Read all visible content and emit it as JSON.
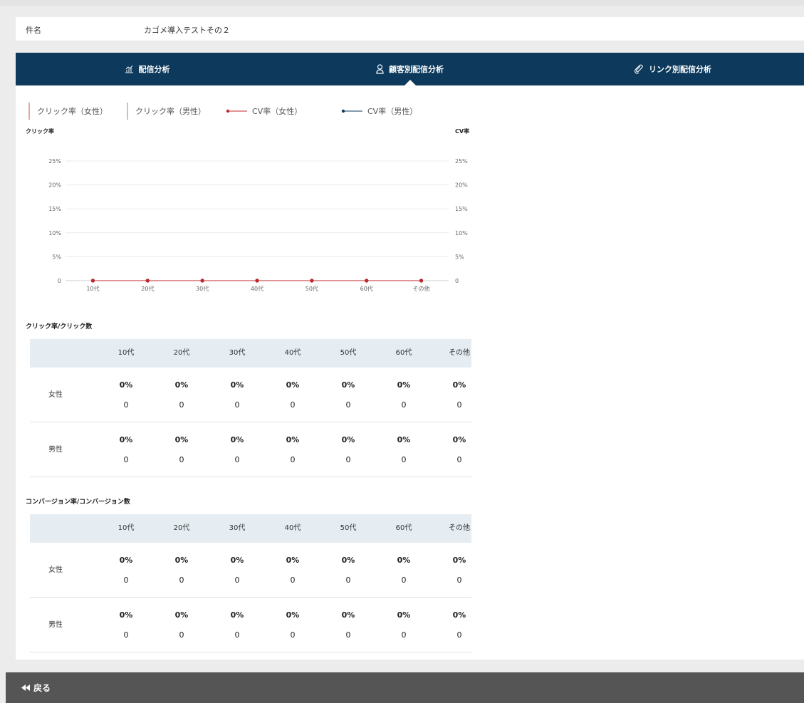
{
  "subject": {
    "label": "件名",
    "value": "カゴメ導入テストその２"
  },
  "tabs": [
    {
      "label": "配信分析",
      "icon": "bar-chart-icon"
    },
    {
      "label": "顧客別配信分析",
      "icon": "person-icon"
    },
    {
      "label": "リンク別配信分析",
      "icon": "paperclip-icon"
    }
  ],
  "legend": [
    {
      "label": "クリック率（女性）",
      "color": "#e8a3a3",
      "kind": "bar"
    },
    {
      "label": "クリック率（男性）",
      "color": "#a9cfcf",
      "kind": "bar"
    },
    {
      "label": "CV率（女性）",
      "color": "#c0282d",
      "kind": "line"
    },
    {
      "label": "CV率（男性）",
      "color": "#0d3a5c",
      "kind": "line"
    }
  ],
  "chart_data": {
    "type": "line",
    "categories": [
      "10代",
      "20代",
      "30代",
      "40代",
      "50代",
      "60代",
      "その他"
    ],
    "ylabel_left": "クリック率",
    "ylabel_right": "CV率",
    "yticks_left": [
      "0",
      "5%",
      "10%",
      "15%",
      "20%",
      "25%"
    ],
    "yticks_right": [
      "0",
      "5%",
      "10%",
      "15%",
      "20%",
      "25%"
    ],
    "ylim": [
      0,
      25
    ],
    "grid": true,
    "series": [
      {
        "name": "クリック率（女性）",
        "type": "bar",
        "values": [
          0,
          0,
          0,
          0,
          0,
          0,
          0
        ],
        "color": "#e8a3a3"
      },
      {
        "name": "クリック率（男性）",
        "type": "bar",
        "values": [
          0,
          0,
          0,
          0,
          0,
          0,
          0
        ],
        "color": "#a9cfcf"
      },
      {
        "name": "CV率（女性）",
        "type": "line",
        "values": [
          0,
          0,
          0,
          0,
          0,
          0,
          0
        ],
        "color": "#c0282d"
      },
      {
        "name": "CV率（男性）",
        "type": "line",
        "values": [
          0,
          0,
          0,
          0,
          0,
          0,
          0
        ],
        "color": "#0d3a5c"
      }
    ]
  },
  "click_table": {
    "title": "クリック率/クリック数",
    "columns": [
      "10代",
      "20代",
      "30代",
      "40代",
      "50代",
      "60代",
      "その他"
    ],
    "rows": [
      {
        "label": "女性",
        "pct": [
          "0%",
          "0%",
          "0%",
          "0%",
          "0%",
          "0%",
          "0%"
        ],
        "count": [
          "0",
          "0",
          "0",
          "0",
          "0",
          "0",
          "0"
        ]
      },
      {
        "label": "男性",
        "pct": [
          "0%",
          "0%",
          "0%",
          "0%",
          "0%",
          "0%",
          "0%"
        ],
        "count": [
          "0",
          "0",
          "0",
          "0",
          "0",
          "0",
          "0"
        ]
      }
    ]
  },
  "cv_table": {
    "title": "コンバージョン率/コンバージョン数",
    "columns": [
      "10代",
      "20代",
      "30代",
      "40代",
      "50代",
      "60代",
      "その他"
    ],
    "rows": [
      {
        "label": "女性",
        "pct": [
          "0%",
          "0%",
          "0%",
          "0%",
          "0%",
          "0%",
          "0%"
        ],
        "count": [
          "0",
          "0",
          "0",
          "0",
          "0",
          "0",
          "0"
        ]
      },
      {
        "label": "男性",
        "pct": [
          "0%",
          "0%",
          "0%",
          "0%",
          "0%",
          "0%",
          "0%"
        ],
        "count": [
          "0",
          "0",
          "0",
          "0",
          "0",
          "0",
          "0"
        ]
      }
    ]
  },
  "footer": {
    "back_label": "戻る",
    "back_icon": "double-left-arrow-icon"
  }
}
